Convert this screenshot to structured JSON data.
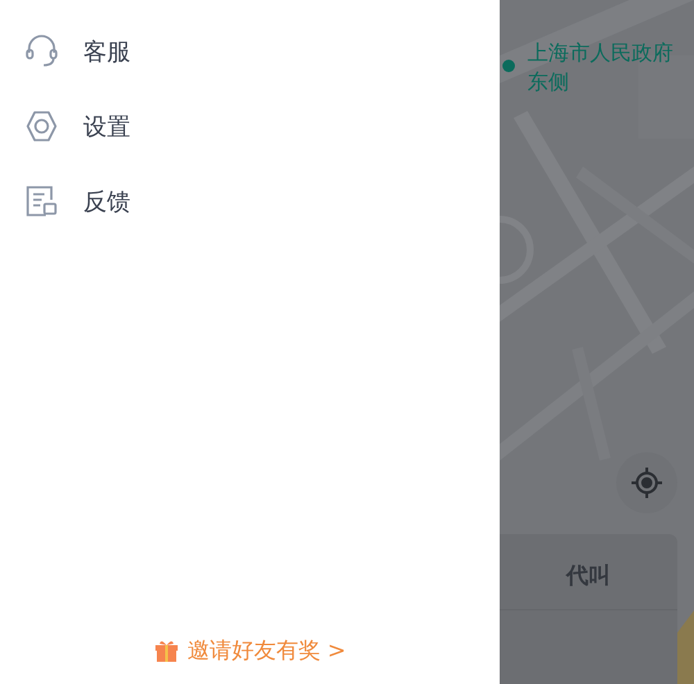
{
  "drawer": {
    "menu": [
      {
        "kind": "support",
        "label": "客服"
      },
      {
        "kind": "settings",
        "label": "设置"
      },
      {
        "kind": "feedback",
        "label": "反馈"
      }
    ],
    "invite": {
      "label": "邀请好友有奖 >"
    }
  },
  "map": {
    "kind": "picture",
    "pin": {
      "label": "上海市人民政府东侧"
    },
    "card": {
      "tab": "代叫"
    }
  }
}
